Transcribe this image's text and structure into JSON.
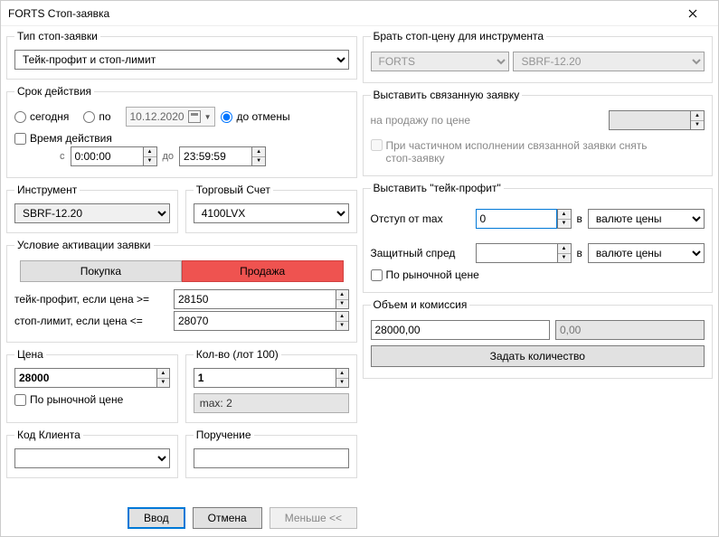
{
  "titlebar": {
    "title": "FORTS Стоп-заявка"
  },
  "stopType": {
    "legend": "Тип стоп-заявки",
    "value": "Тейк-профит и стоп-лимит"
  },
  "validity": {
    "legend": "Срок действия",
    "today": "сегодня",
    "until": "по",
    "date": "10.12.2020",
    "gtc": "до отмены",
    "timeLabel": "Время действия",
    "fromLabel": "с",
    "from": "0:00:00",
    "toLabel": "до",
    "to": "23:59:59"
  },
  "instrument": {
    "legend": "Инструмент",
    "value": "SBRF-12.20",
    "accountLegend": "Торговый Счет",
    "account": "4100LVX"
  },
  "activation": {
    "legend": "Условие активации заявки",
    "buy": "Покупка",
    "sell": "Продажа",
    "tpLabel": "тейк-профит, если цена >=",
    "tpValue": "28150",
    "slLabel": "стоп-лимит, если цена <=",
    "slValue": "28070"
  },
  "price": {
    "legend": "Цена",
    "value": "28000",
    "marketLabel": "По рыночной цене"
  },
  "qty": {
    "legend": "Кол-во (лот 100)",
    "value": "1",
    "maxLabel": "max: 2"
  },
  "client": {
    "legend": "Код Клиента",
    "value": ""
  },
  "order": {
    "legend": "Поручение",
    "value": ""
  },
  "footer": {
    "submit": "Ввод",
    "cancel": "Отмена",
    "less": "Меньше <<"
  },
  "source": {
    "legend": "Брать стоп-цену для инструмента",
    "market": "FORTS",
    "instrument": "SBRF-12.20"
  },
  "linked": {
    "legend": "Выставить связанную заявку",
    "sellAtLabel": "на продажу по цене",
    "partialLabel": "При частичном исполнении связанной заявки снять стоп-заявку"
  },
  "tp": {
    "legend": "Выставить \"тейк-профит\"",
    "offsetLabel": "Отступ от max",
    "offsetValue": "0",
    "inLabel": "в",
    "unit": "валюте цены",
    "spreadLabel": "Защитный спред",
    "spreadValue": "",
    "marketLabel": "По рыночной цене"
  },
  "volume": {
    "legend": "Объем и комиссия",
    "amount": "28000,00",
    "commission": "0,00",
    "setQty": "Задать количество"
  }
}
